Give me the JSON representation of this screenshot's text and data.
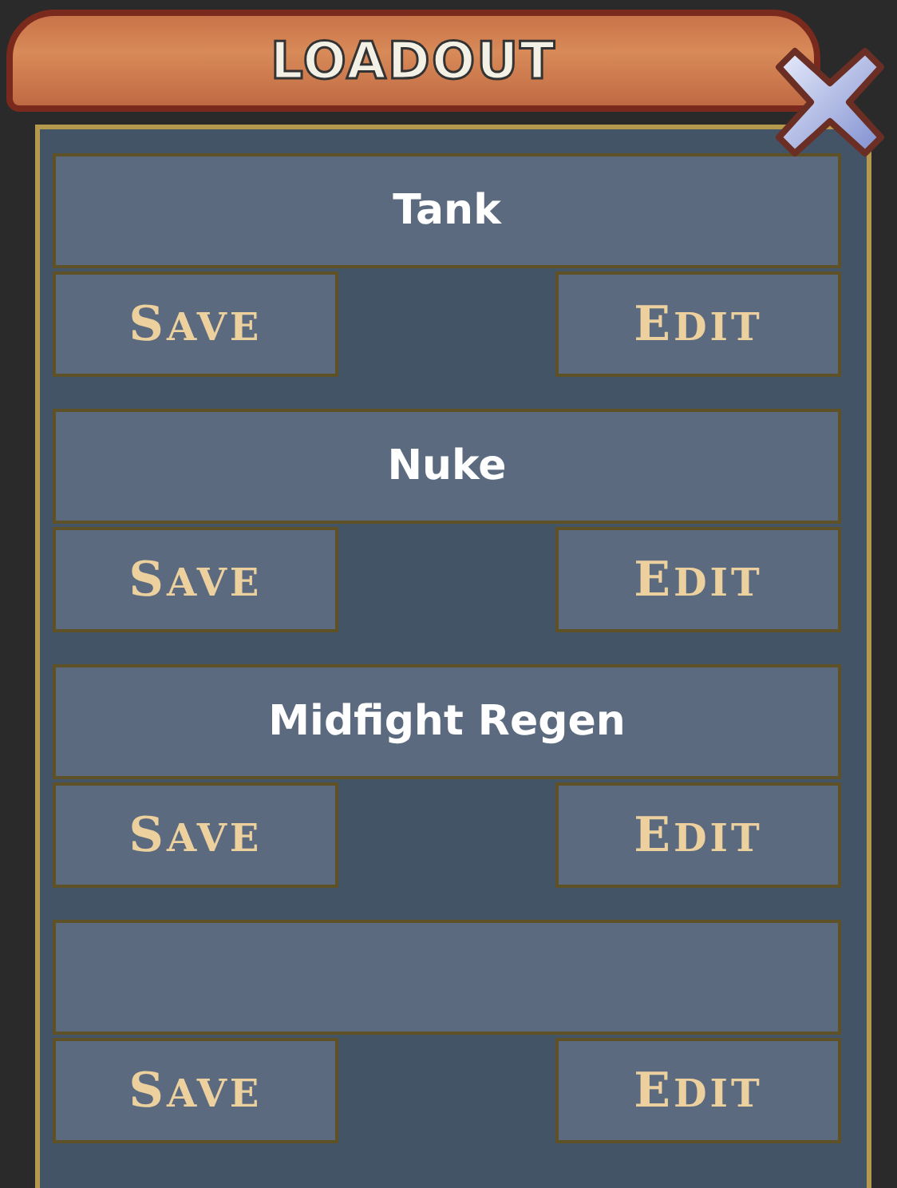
{
  "window": {
    "title": "LOADOUT"
  },
  "slots": [
    {
      "name": "Tank",
      "buttons": [
        "SAVE",
        "EDIT"
      ]
    },
    {
      "name": "Nuke",
      "buttons": [
        "SAVE",
        "EDIT"
      ]
    },
    {
      "name": "Midfight Regen",
      "buttons": [
        "SAVE",
        "EDIT"
      ]
    },
    {
      "buttons": [
        "SAVE",
        "EDIT"
      ]
    }
  ]
}
